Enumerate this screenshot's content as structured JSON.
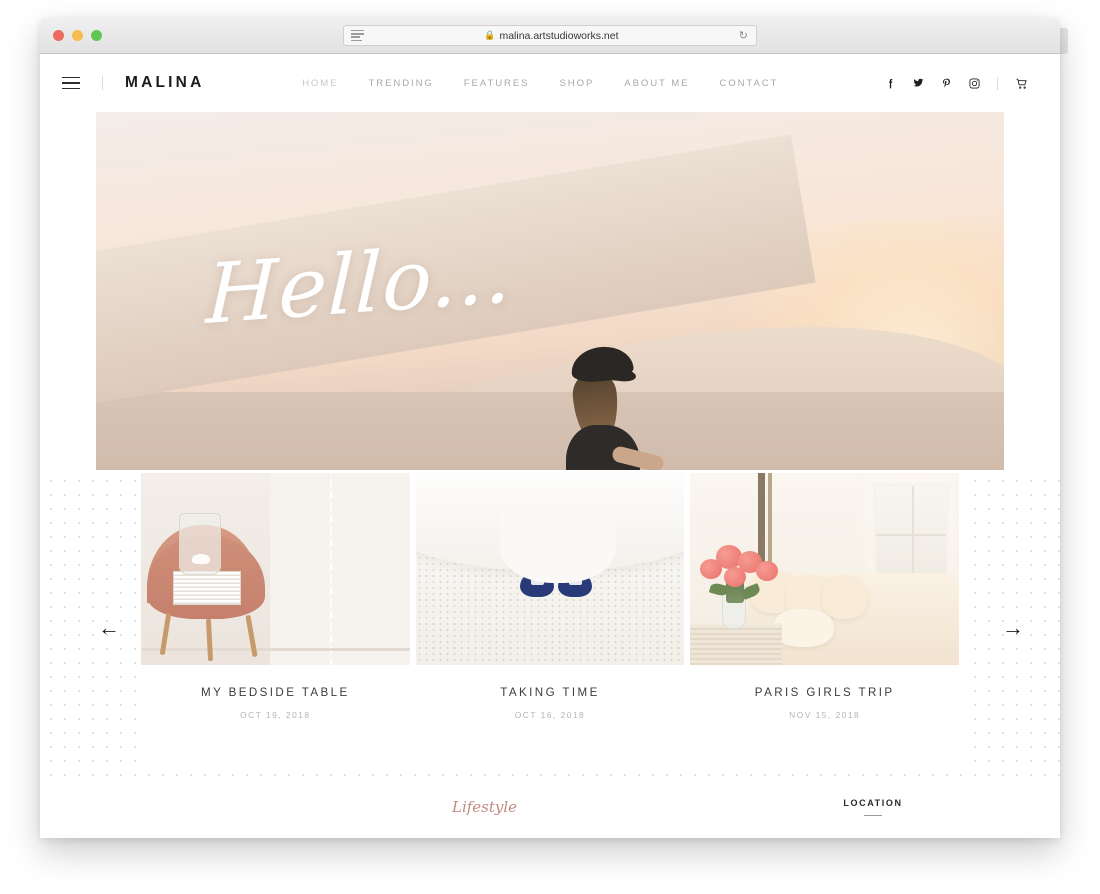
{
  "browser": {
    "url": "malina.artstudioworks.net",
    "lock_icon": "lock-icon",
    "reader_icon": "reader-view-icon",
    "reload_icon": "reload-icon",
    "newtab_label": "+",
    "traffic_lights": [
      "close-red",
      "minimize-yellow",
      "maximize-green"
    ]
  },
  "header": {
    "menu_icon": "hamburger-menu-icon",
    "brand": "MALINA",
    "nav": [
      {
        "label": "HOME",
        "active": true
      },
      {
        "label": "TRENDING",
        "active": false
      },
      {
        "label": "FEATURES",
        "active": false
      },
      {
        "label": "SHOP",
        "active": false
      },
      {
        "label": "ABOUT ME",
        "active": false
      },
      {
        "label": "CONTACT",
        "active": false
      }
    ],
    "socials": [
      {
        "name": "facebook-icon"
      },
      {
        "name": "twitter-icon"
      },
      {
        "name": "pinterest-icon"
      },
      {
        "name": "instagram-icon"
      }
    ],
    "cart_icon": "shopping-cart-icon"
  },
  "hero": {
    "title": "Hello...",
    "alt": "Woman in hat sitting on a desert sand dune at sunset"
  },
  "carousel": {
    "prev_label": "←",
    "next_label": "→",
    "cards": [
      {
        "title": "MY BEDSIDE TABLE",
        "date": "OCT 19, 2018",
        "image": "pink-velvet-chair-with-vase-and-books"
      },
      {
        "title": "TAKING TIME",
        "date": "OCT 16, 2018",
        "image": "blue-shoes-under-white-dress"
      },
      {
        "title": "PARIS GIRLS TRIP",
        "date": "NOV 15, 2018",
        "image": "pink-roses-beside-bed"
      }
    ]
  },
  "footer": {
    "script_text": "Lifestyle",
    "location_label": "LOCATION"
  },
  "colors": {
    "brand_text": "#1c1c1c",
    "nav_inactive": "#a9a9a9",
    "script_accent": "#c08b80",
    "dot_grid": "#e2e2e2"
  }
}
